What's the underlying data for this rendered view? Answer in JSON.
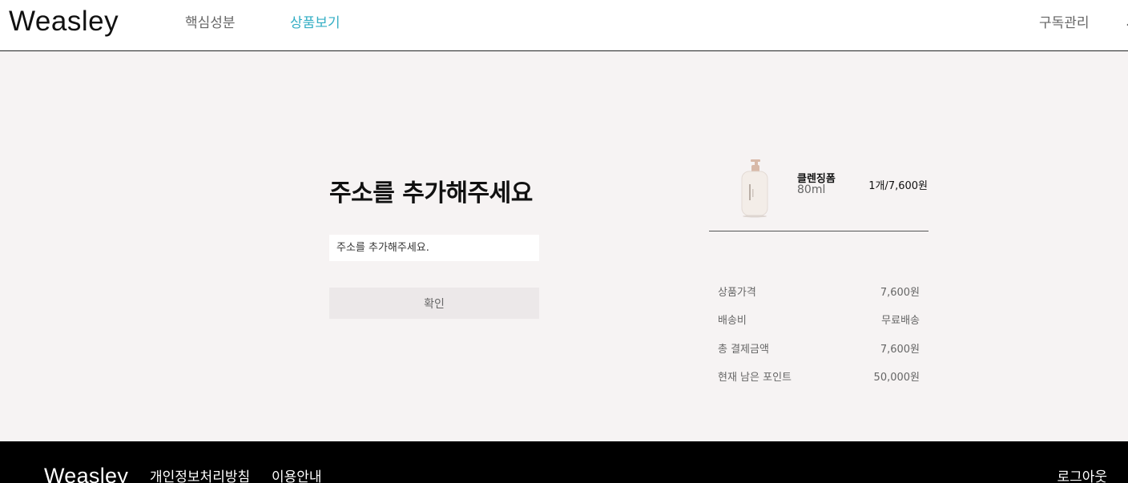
{
  "header": {
    "logo": "Weasley",
    "nav": {
      "ingredients": "핵심성분",
      "products": "상품보기",
      "subscription": "구독관리"
    }
  },
  "form": {
    "title": "주소를 추가해주세요",
    "address_placeholder": "주소를 추가해주세요.",
    "confirm_label": "확인"
  },
  "product": {
    "name": "클렌징폼",
    "volume": "80ml",
    "qty_price": "1개/7,600원",
    "image_icon": "pump-bottle-image"
  },
  "summary": {
    "rows": [
      {
        "label": "상품가격",
        "value": "7,600원"
      },
      {
        "label": "배송비",
        "value": "무료배송"
      },
      {
        "label": "총 결제금액",
        "value": "7,600원"
      },
      {
        "label": "현재 남은 포인트",
        "value": "50,000원"
      }
    ]
  },
  "footer": {
    "logo": "Weasley",
    "privacy": "개인정보처리방침",
    "guide": "이용안내",
    "logout": "로그아웃"
  },
  "colors": {
    "accent": "#33aec4",
    "background": "#f6f3f3",
    "footer": "#000000"
  }
}
